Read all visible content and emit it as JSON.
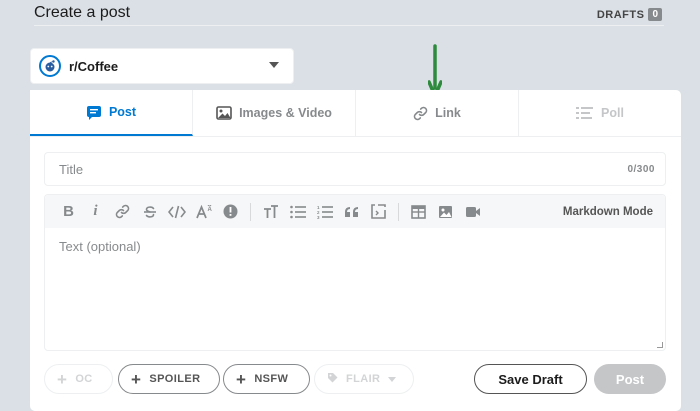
{
  "header": {
    "title": "Create a post",
    "drafts_label": "DRAFTS",
    "drafts_count": "0"
  },
  "community": {
    "name": "r/Coffee",
    "avatar_icon": "reddit-snoo-icon",
    "chevron_icon": "chevron-down-icon"
  },
  "annotation": {
    "icon": "down-arrow-icon",
    "color": "#2e8b3d"
  },
  "tabs": [
    {
      "label": "Post",
      "icon": "post-icon",
      "state": "active"
    },
    {
      "label": "Images & Video",
      "icon": "image-icon",
      "state": "normal"
    },
    {
      "label": "Link",
      "icon": "link-icon",
      "state": "normal"
    },
    {
      "label": "Poll",
      "icon": "poll-icon",
      "state": "disabled"
    }
  ],
  "title_field": {
    "placeholder": "Title",
    "value": "",
    "counter": "0/300"
  },
  "toolbar": {
    "buttons": [
      "bold-icon",
      "italic-icon",
      "link-icon",
      "strikethrough-icon",
      "inline-code-icon",
      "superscript-icon",
      "spoiler-icon",
      "heading-icon",
      "bulleted-list-icon",
      "numbered-list-icon",
      "quote-block-icon",
      "code-block-icon",
      "table-icon",
      "image-icon",
      "video-icon"
    ],
    "bold": "B",
    "italic": "i",
    "markdown_mode": "Markdown Mode"
  },
  "editor": {
    "placeholder": "Text (optional)",
    "value": ""
  },
  "footer": {
    "oc_label": "OC",
    "spoiler_label": "SPOILER",
    "nsfw_label": "NSFW",
    "flair_label": "FLAIR",
    "save_draft_label": "Save Draft",
    "post_label": "Post"
  },
  "colors": {
    "background": "#dae0e6",
    "accent": "#0079d3",
    "disabled": "#c4c6c8"
  }
}
